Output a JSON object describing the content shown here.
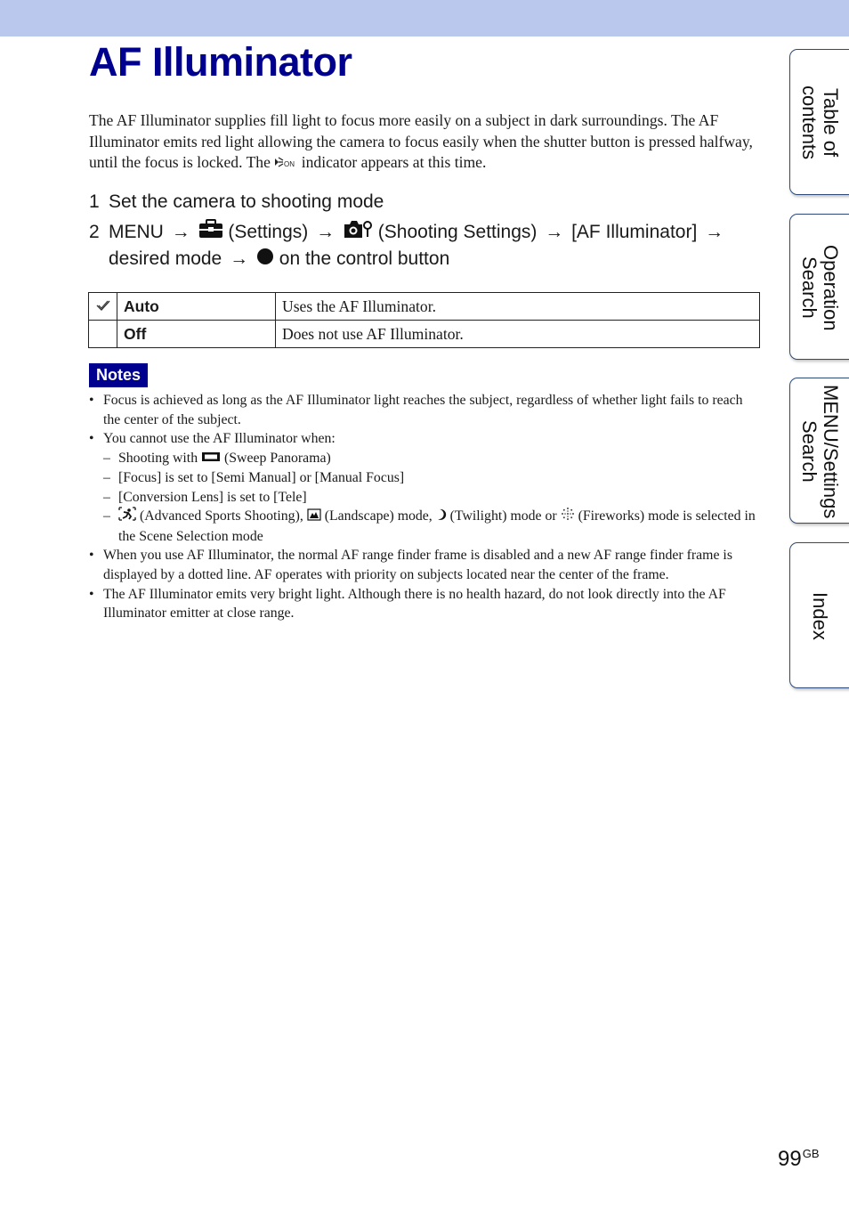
{
  "page": {
    "title": "AF Illuminator",
    "intro": {
      "line1": "The AF Illuminator supplies fill light to focus more easily on a subject in dark surroundings.",
      "line2": "The AF Illuminator emits red light allowing the camera to focus easily when the shutter button is pressed halfway, until the focus is locked. The",
      "indicator_icon": "af-illuminator-on-icon",
      "line3": "indicator appears at this time."
    },
    "steps": [
      {
        "number": "1",
        "text": "Set the camera to shooting mode"
      },
      {
        "number": "2",
        "parts": {
          "menu": "MENU",
          "settings_icon": "toolbox-icon",
          "settings": "(Settings)",
          "shooting_icon": "camera-settings-icon",
          "shooting_settings": "(Shooting Settings)",
          "item": "[AF Illuminator]",
          "desired": "desired mode",
          "button_icon": "filled-circle-icon",
          "control": "on the control button"
        }
      }
    ],
    "modes_table": [
      {
        "default": true,
        "default_icon": "checkmark-icon",
        "mode": "Auto",
        "description": "Uses the AF Illuminator."
      },
      {
        "default": false,
        "mode": "Off",
        "description": "Does not use AF Illuminator."
      }
    ],
    "notes": {
      "badge": "Notes",
      "items": [
        {
          "text": "Focus is achieved as long as the AF Illuminator light reaches the subject, regardless of whether light fails to reach the center of the subject."
        },
        {
          "text": "You cannot use the AF Illuminator when:",
          "sub": {
            "s1_pre": "Shooting with",
            "s1_icon": "sweep-panorama-icon",
            "s1_post": "(Sweep Panorama)",
            "s2": "[Focus] is set to [Semi Manual] or [Manual Focus]",
            "s3": "[Conversion Lens] is set to [Tele]",
            "s4_sports_icon": "advanced-sports-icon",
            "s4_sports": "(Advanced Sports Shooting),",
            "s4_landscape_icon": "landscape-icon",
            "s4_landscape": "(Landscape) mode,",
            "s4_twilight_icon": "twilight-icon",
            "s4_twilight": "(Twilight) mode or",
            "s4_fireworks_icon": "fireworks-icon",
            "s4_fireworks": "(Fireworks) mode is selected in the Scene Selection mode"
          }
        },
        {
          "text": "When you use AF Illuminator, the normal AF range finder frame is disabled and a new AF range finder frame is displayed by a dotted line. AF operates with priority on subjects located near the center of the frame."
        },
        {
          "text": "The AF Illuminator emits very bright light. Although there is no health hazard, do not look directly into the AF Illuminator emitter at close range."
        }
      ]
    },
    "bullet": "•",
    "dash": "–",
    "arrow": "→"
  },
  "side_tabs": [
    {
      "label": "Table of contents"
    },
    {
      "label": "Operation Search"
    },
    {
      "label": "MENU/Settings Search"
    },
    {
      "label": "Index"
    }
  ],
  "footer": {
    "page_number": "99",
    "suffix": "GB"
  },
  "colors": {
    "band": "#b9c8ec",
    "title": "#00008f",
    "notes_badge": "#00008f",
    "tab_border": "#2d4b78"
  }
}
